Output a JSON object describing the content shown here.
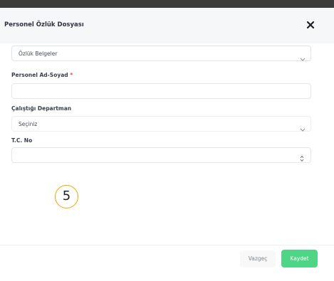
{
  "dialog": {
    "title": "Personel Özlük Dosyası",
    "close_icon": "close-icon"
  },
  "form": {
    "document_type": {
      "value": "Özlük Belgeler"
    },
    "full_name": {
      "label": "Personel Ad-Soyad",
      "required_mark": "*",
      "value": ""
    },
    "department": {
      "label": "Çalıştığı Departman",
      "value": "Seçiniz"
    },
    "tc_no": {
      "label": "T.C. No",
      "value": ""
    }
  },
  "annotation": {
    "step_number": "5"
  },
  "footer": {
    "cancel_label": "Vazgeç",
    "save_label": "Kaydet",
    "save_color": "#4ed585"
  }
}
